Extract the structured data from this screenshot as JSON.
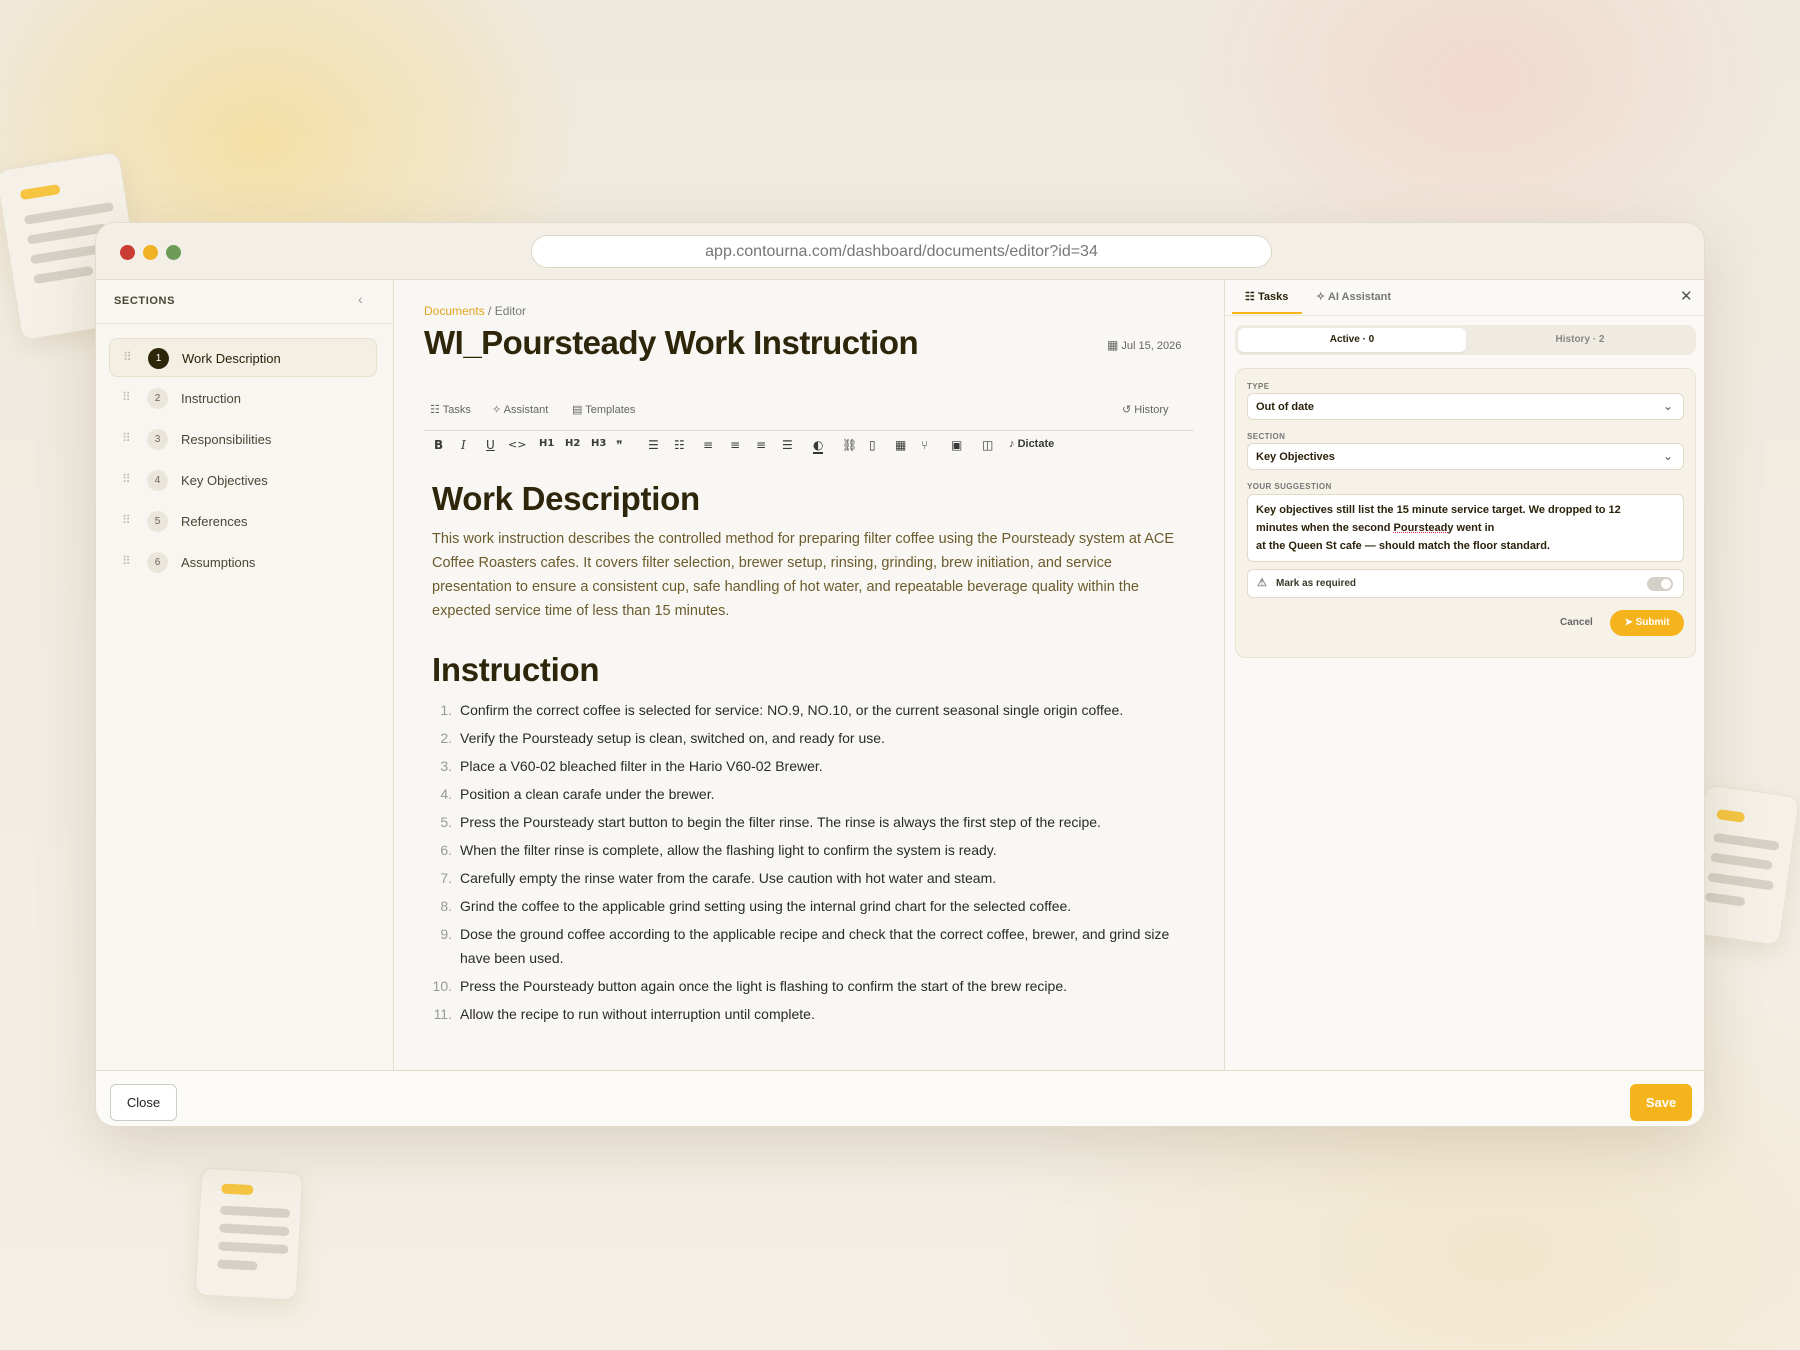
{
  "browser": {
    "url": "app.contourna.com/dashboard/documents/editor?id=34",
    "dots": [
      "#c93b33",
      "#f0b127",
      "#6e9b57"
    ]
  },
  "sidebar": {
    "title": "SECTIONS",
    "collapse_icon": "‹",
    "items": [
      {
        "num": "1",
        "label": "Work Description"
      },
      {
        "num": "2",
        "label": "Instruction"
      },
      {
        "num": "3",
        "label": "Responsibilities"
      },
      {
        "num": "4",
        "label": "Key Objectives"
      },
      {
        "num": "5",
        "label": "References"
      },
      {
        "num": "6",
        "label": "Assumptions"
      }
    ]
  },
  "editor": {
    "breadcrumb": {
      "link": "Documents",
      "rest": " / Editor"
    },
    "title": "WI_Poursteady Work Instruction",
    "date": "Jul 15, 2026",
    "tabs": {
      "tasks": "Tasks",
      "assistant": "Assistant",
      "templates": "Templates",
      "history": "History"
    },
    "toolbar": {
      "bold": "B",
      "italic": "I",
      "underline": "U",
      "code": "<>",
      "h1": "H1",
      "h2": "H2",
      "h3": "H3",
      "quote": "❞",
      "dictate": "Dictate"
    },
    "section1": {
      "heading": "Work Description",
      "body": "This work instruction describes the controlled method for preparing filter coffee using the Poursteady system at ACE Coffee Roasters cafes. It covers filter selection, brewer setup, rinsing, grinding, brew initiation, and service presentation to ensure a consistent cup, safe handling of hot water, and repeatable beverage quality within the expected service time of less than 15 minutes."
    },
    "section2": {
      "heading": "Instruction",
      "steps": [
        {
          "n": "1.",
          "text": "Confirm the correct coffee is selected for service: NO.9, NO.10, or the current seasonal single origin coffee."
        },
        {
          "n": "2.",
          "text": "Verify the Poursteady setup is clean, switched on, and ready for use."
        },
        {
          "n": "3.",
          "text": "Place a V60-02 bleached filter in the Hario V60-02 Brewer."
        },
        {
          "n": "4.",
          "text": "Position a clean carafe under the brewer."
        },
        {
          "n": "5.",
          "text": "Press the Poursteady start button to begin the filter rinse. The rinse is always the first step of the recipe."
        },
        {
          "n": "6.",
          "text": "When the filter rinse is complete, allow the flashing light to confirm the system is ready."
        },
        {
          "n": "7.",
          "text": "Carefully empty the rinse water from the carafe. Use caution with hot water and steam."
        },
        {
          "n": "8.",
          "text": "Grind the coffee to the applicable grind setting using the internal grind chart for the selected coffee."
        },
        {
          "n": "9.",
          "text": "Dose the ground coffee according to the applicable recipe and check that the correct coffee, brewer, and grind size have been used."
        },
        {
          "n": "10.",
          "text": "Press the Poursteady button again once the light is flashing to confirm the start of the brew recipe."
        },
        {
          "n": "11.",
          "text": "Allow the recipe to run without interruption until complete."
        }
      ]
    }
  },
  "panel": {
    "tabs": {
      "tasks": "Tasks",
      "ai": "AI Assistant"
    },
    "segments": {
      "active": "Active · 0",
      "history": "History · 2"
    },
    "type_label": "TYPE",
    "type_value": "Out of date",
    "section_label": "SECTION",
    "section_value": "Key Objectives",
    "suggestion_label": "YOUR SUGGESTION",
    "suggestion": {
      "line1": "Key objectives still list the 15 minute service target. We dropped to 12",
      "line2a": "minutes when the second ",
      "line2u": "Poursteady",
      "line2b": " went in",
      "line3": " at the Queen St cafe — should match the floor standard."
    },
    "mark_required": "Mark as required",
    "cancel": "Cancel",
    "submit": "Submit"
  },
  "footer": {
    "close": "Close",
    "save": "Save"
  },
  "colors": {
    "accent": "#f5b41c",
    "title": "#2e260b",
    "body_text": "#6b5b2d"
  }
}
